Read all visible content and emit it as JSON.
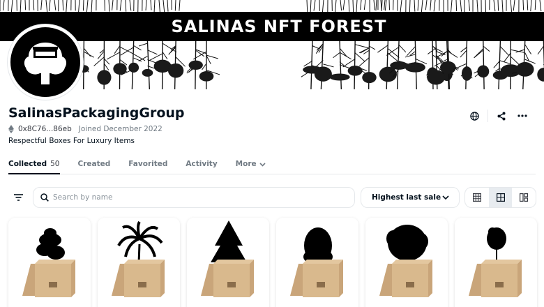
{
  "banner": {
    "title": "SALINAS NFT FOREST"
  },
  "profile": {
    "name": "SalinasPackagingGroup",
    "address": "0x8C76...86eb",
    "joined": "Joined December 2022",
    "bio": "Respectful Boxes For Luxury Items"
  },
  "tabs": [
    {
      "label": "Collected",
      "count": "50"
    },
    {
      "label": "Created"
    },
    {
      "label": "Favorited"
    },
    {
      "label": "Activity"
    },
    {
      "label": "More"
    }
  ],
  "search": {
    "placeholder": "Search by name"
  },
  "sort": {
    "selected": "Highest last sale"
  },
  "colors": {
    "text": "#04111d",
    "muted": "#707a83",
    "border": "#e5e8eb",
    "box": "#d9b98d"
  },
  "icons": [
    "globe-icon",
    "share-icon",
    "more-icon",
    "filter-icon",
    "search-icon",
    "chevron-down-icon",
    "grid-large-icon",
    "grid-small-icon",
    "mosaic-icon",
    "ethereum-icon"
  ],
  "cards": [
    {
      "tree": "broadleaf"
    },
    {
      "tree": "palm"
    },
    {
      "tree": "conifer"
    },
    {
      "tree": "bushy"
    },
    {
      "tree": "oak"
    },
    {
      "tree": "slender"
    }
  ]
}
